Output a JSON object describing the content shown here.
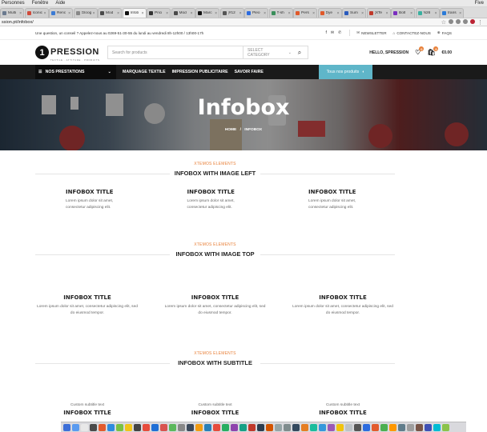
{
  "menubar": {
    "items": [
      "Personnes",
      "Fenêtre",
      "Aide"
    ],
    "right": "Five"
  },
  "tabs": [
    {
      "label": "Multi",
      "color": "#6b7a8f"
    },
    {
      "label": "Iconic",
      "color": "#d04a3a"
    },
    {
      "label": "Renc",
      "color": "#3c7bd4"
    },
    {
      "label": "Gloog",
      "color": "#888888"
    },
    {
      "label": "Mod",
      "color": "#4a4a4a"
    },
    {
      "label": "Infob",
      "color": "#111111",
      "active": true
    },
    {
      "label": "Prici",
      "color": "#333333"
    },
    {
      "label": "Mod",
      "color": "#4a4a4a"
    },
    {
      "label": "Marc",
      "color": "#111111"
    },
    {
      "label": "[#12",
      "color": "#555555"
    },
    {
      "label": "Pleo",
      "color": "#2d6cdf"
    },
    {
      "label": "T-sh",
      "color": "#3b8f5b"
    },
    {
      "label": "Pers",
      "color": "#e0592a"
    },
    {
      "label": "Dye",
      "color": "#e0592a"
    },
    {
      "label": "Sum",
      "color": "#2a5bbd"
    },
    {
      "label": "[XTe",
      "color": "#c0392b"
    },
    {
      "label": "Bolt",
      "color": "#7b2fbf"
    },
    {
      "label": "N26",
      "color": "#3ab0a0"
    },
    {
      "label": "trans",
      "color": "#2b7bd8"
    }
  ],
  "address": {
    "url": "ssion.pt/infobox/"
  },
  "topinfo": {
    "text": "Une question, un conseil ? Appelez-nous au 0269-51-30-55 du lundi au vendredi 8h-12h00 / 13h00-17h",
    "social": [
      "f",
      "✉",
      "✆"
    ],
    "newsletter": "NEWSLETTER",
    "contact": "CONTACTEZ-NOUS",
    "faqs": "FAQS"
  },
  "header": {
    "logo_number": "1",
    "logo_text": "PRESSION",
    "logo_sub": "TEXTILE · ATTITUDE · PRODUITS",
    "search_placeholder": "Search for products",
    "select_category": "SELECT CATEGORY",
    "greeting": "HELLO, SPRESSION",
    "wishlist_count": "0",
    "cart_count": "0",
    "cart_total": "€0.00"
  },
  "nav": {
    "prestations": "NOS PRESTATIONS",
    "items": [
      "MARQUAGE TEXTILE",
      "IMPRESSION PUBLICITAIRE",
      "SAVOIR FAIRE"
    ],
    "all_products": "Tous nos produits"
  },
  "hero": {
    "title": "Infobox",
    "breadcrumb_home": "HOME",
    "breadcrumb_sep": "/",
    "breadcrumb_current": "INFOBOX"
  },
  "sections": [
    {
      "eyebrow": "XTEMOS ELEMENTS",
      "heading": "INFOBOX WITH IMAGE LEFT",
      "boxes": [
        {
          "title": "INFOBOX TITLE",
          "body": "Lorem ipsum dolor sit amet, consectetur adipiscing elit."
        },
        {
          "title": "INFOBOX TITLE",
          "body": "Lorem ipsum dolor sit amet, consectetur adipiscing elit."
        },
        {
          "title": "INFOBOX TITLE",
          "body": "Lorem ipsum dolor sit amet, consectetur adipiscing elit."
        }
      ]
    },
    {
      "eyebrow": "XTEMOS ELEMENTS",
      "heading": "INFOBOX WITH IMAGE TOP",
      "boxes": [
        {
          "title": "INFOBOX TITLE",
          "body": "Lorem ipsum dolor sit amet, consectetur adipiscing elit, sed do eiusmod tempor."
        },
        {
          "title": "INFOBOX TITLE",
          "body": "Lorem ipsum dolor sit amet, consectetur adipiscing elit, sed do eiusmod tempor."
        },
        {
          "title": "INFOBOX TITLE",
          "body": "Lorem ipsum dolor sit amet, consectetur adipiscing elit, sed do eiusmod tempor."
        }
      ]
    },
    {
      "eyebrow": "XTEMOS ELEMENTS",
      "heading": "INFOBOX WITH SUBTITLE",
      "boxes": [
        {
          "subtitle": "Custom subtitle text",
          "title": "INFOBOX TITLE"
        },
        {
          "subtitle": "Custom subtitle text",
          "title": "INFOBOX TITLE"
        },
        {
          "subtitle": "Custom subtitle text",
          "title": "INFOBOX TITLE"
        }
      ]
    }
  ],
  "colors": {
    "accent": "#e8813a",
    "nav_bg": "#1a1a1a",
    "all_products_bg": "#5fb6c9"
  },
  "dock_colors": [
    "#3d6fd8",
    "#5a9bf0",
    "#e8e8e8",
    "#4a4a4a",
    "#e35b2d",
    "#2f8cde",
    "#7ac143",
    "#f0c419",
    "#444444",
    "#e74c3c",
    "#1f6fd6",
    "#d9534f",
    "#5cb85c",
    "#888888",
    "#3c4a5c",
    "#f39c12",
    "#2980b9",
    "#e74c3c",
    "#27ae60",
    "#8e44ad",
    "#16a085",
    "#c0392b",
    "#2c3e50",
    "#d35400",
    "#95a5a6",
    "#7f8c8d",
    "#34495e",
    "#e67e22",
    "#1abc9c",
    "#3498db",
    "#9b59b6",
    "#f1c40f",
    "#bdc3c7",
    "#555555",
    "#2d6cdf",
    "#e35b2d",
    "#4caf50",
    "#ff9800",
    "#607d8b",
    "#9e9e9e",
    "#795548",
    "#3f51b5",
    "#00bcd4",
    "#8bc34a"
  ]
}
